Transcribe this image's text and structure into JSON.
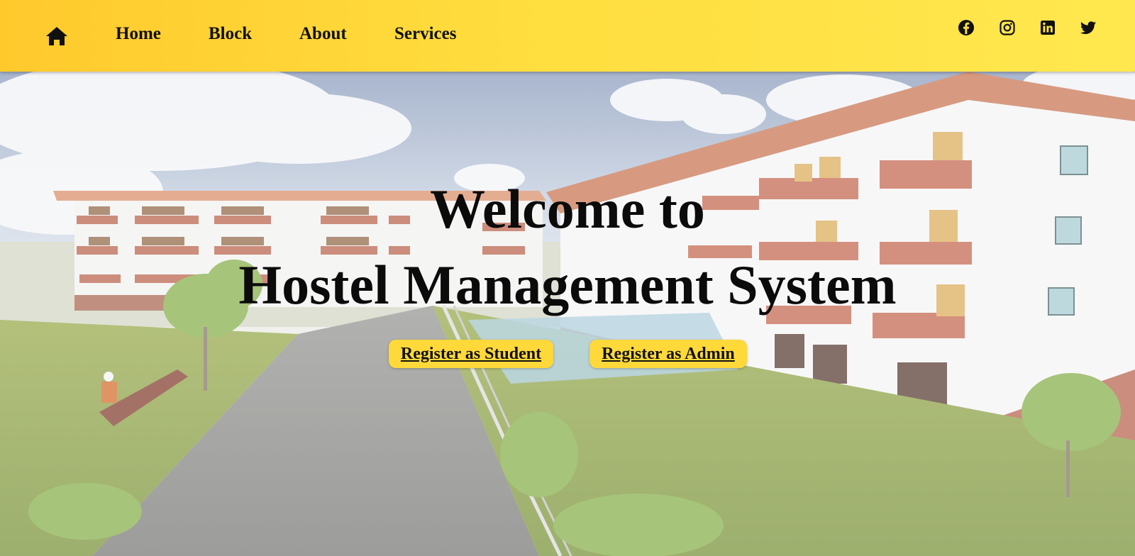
{
  "nav": {
    "links": [
      "Home",
      "Block",
      "About",
      "Services"
    ],
    "icons": {
      "home": "home-icon",
      "social": [
        "facebook-icon",
        "instagram-icon",
        "linkedin-icon",
        "twitter-icon"
      ]
    },
    "colors": {
      "bar_start": "#ffc92c",
      "bar_end": "#ffe84f"
    }
  },
  "hero": {
    "title_line1": "Welcome to",
    "title_line2": "Hostel Management System",
    "buttons": {
      "student": "Register as Student",
      "admin": "Register as Admin"
    },
    "button_color": "#ffd93a"
  }
}
